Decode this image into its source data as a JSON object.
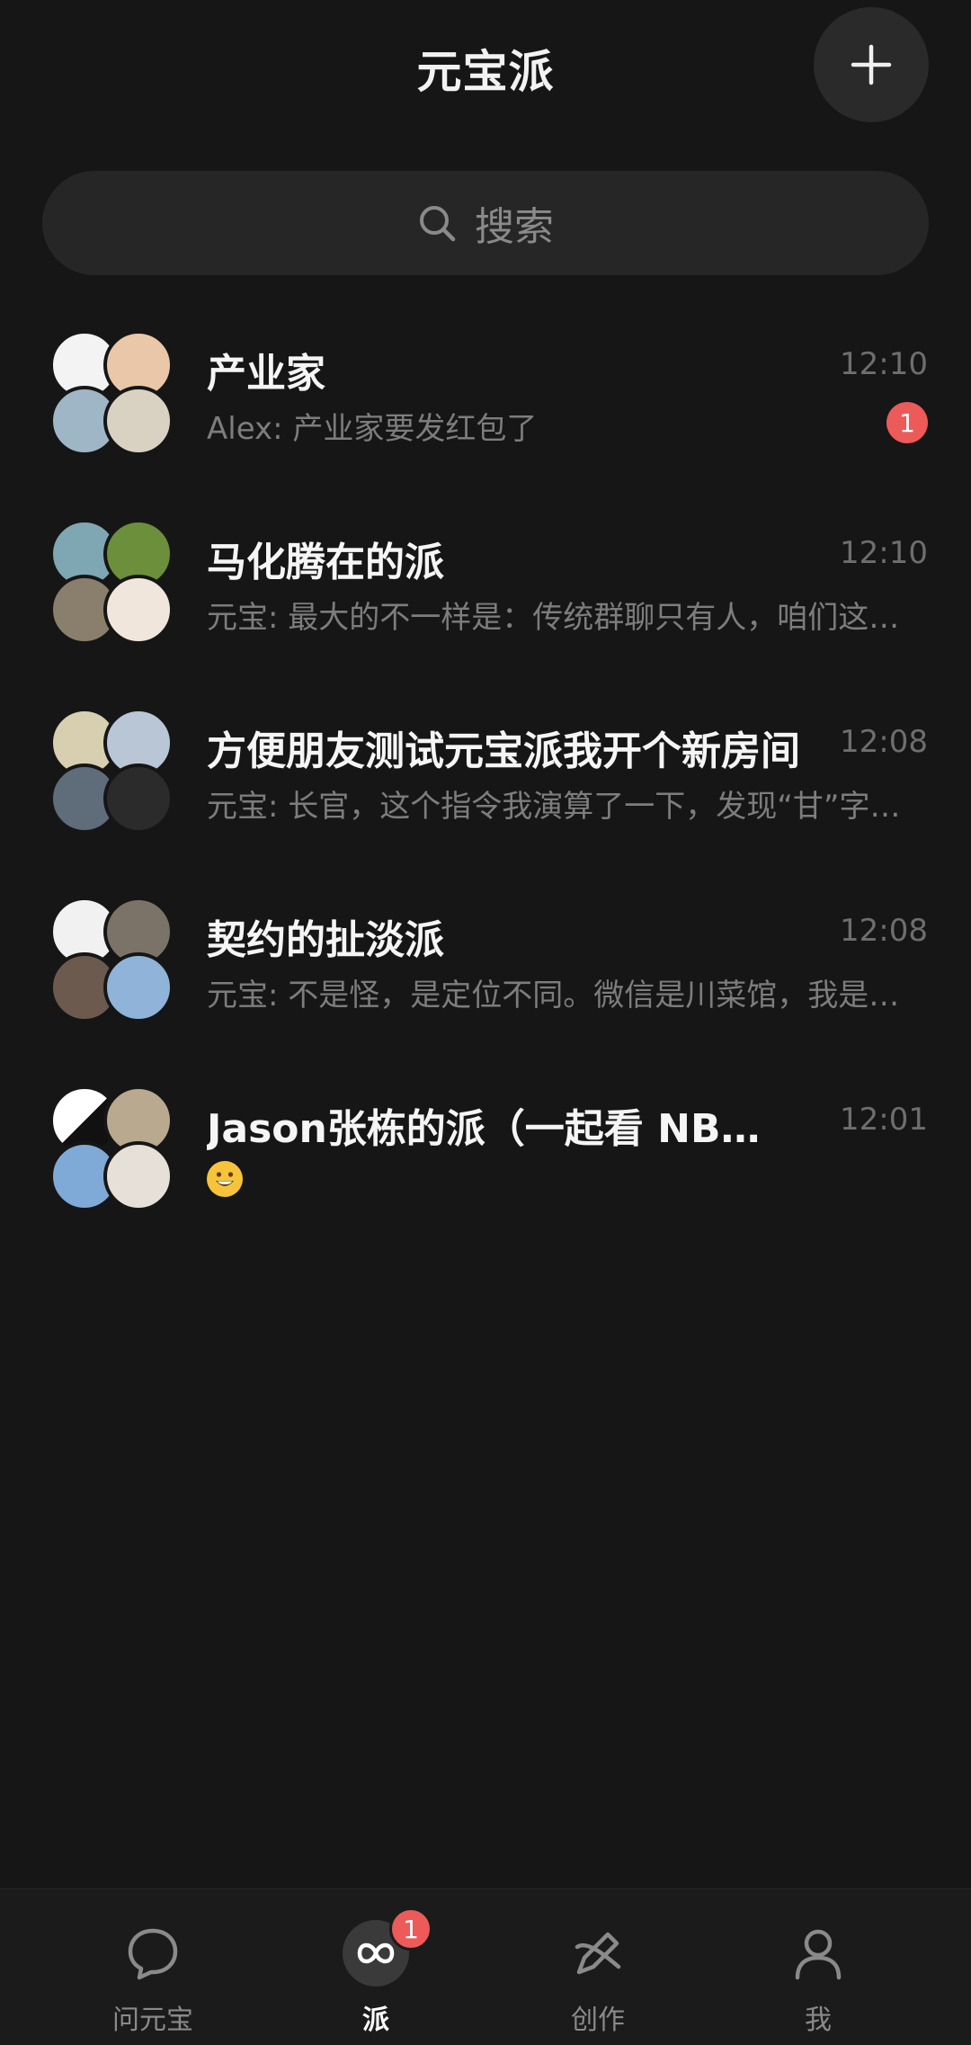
{
  "header": {
    "title": "元宝派",
    "add_icon": "plus-icon"
  },
  "search": {
    "icon": "search-icon",
    "placeholder": "搜索"
  },
  "chats": [
    {
      "name": "产业家",
      "time": "12:10",
      "preview": "Alex: 产业家要发红包了",
      "unread": "1",
      "avatar_colors": [
        "#f3f3f3",
        "#e9c7a8",
        "#9fb6c6",
        "#d9d2c2"
      ]
    },
    {
      "name": "马化腾在的派",
      "time": "12:10",
      "preview": "元宝: 最大的不一样是：传统群聊只有人，咱们这…",
      "avatar_colors": [
        "#7fa6b3",
        "#6b8f3a",
        "#8a7f6c",
        "#f1e6dc"
      ]
    },
    {
      "name": "方便朋友测试元宝派我开个新房间",
      "time": "12:08",
      "preview": "元宝: 长官，这个指令我演算了一下，发现“甘”字…",
      "avatar_colors": [
        "#d7cfb0",
        "#b9c6d6",
        "#5f6c7a",
        "#2b2b2b"
      ]
    },
    {
      "name": "契约的扯淡派",
      "time": "12:08",
      "preview": "元宝: 不是怪，是定位不同。微信是川菜馆，我是…",
      "avatar_colors": [
        "#f1f1f1",
        "#7b7367",
        "#6d5a4e",
        "#8fb3d9"
      ]
    },
    {
      "name": "Jason张栋的派（一起看 NBA...",
      "time": "12:01",
      "preview": "",
      "preview_emoji": "grinning-face-emoji",
      "avatar_colors": [
        "#ffffff",
        "#b8a98f",
        "#7fa9d6",
        "#e6e0d8"
      ]
    }
  ],
  "bottom_nav": {
    "items": [
      {
        "label": "问元宝",
        "icon": "chat-bubble-icon",
        "active": false
      },
      {
        "label": "派",
        "icon": "infinity-icon",
        "active": true,
        "badge": "1"
      },
      {
        "label": "创作",
        "icon": "pen-icon",
        "active": false
      },
      {
        "label": "我",
        "icon": "person-icon",
        "active": false
      }
    ]
  }
}
